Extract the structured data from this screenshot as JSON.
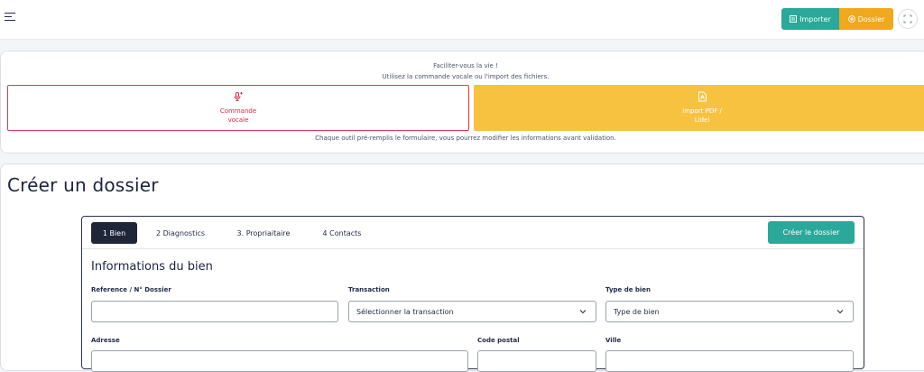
{
  "topbar": {
    "import_label": "Importer",
    "dossier_label": "Dossier",
    "colors": {
      "import": "#2aa899",
      "dossier": "#f0a81c"
    }
  },
  "helper": {
    "line1": "Faciliter-vous la vie !",
    "line2": "Utilisez la commande vocale ou l'import des fichiers.",
    "voice_label_1": "Commande",
    "voice_label_2": "vocale",
    "pdf_label_1": "Import PDF /",
    "pdf_label_2": "Lidel",
    "footer": "Chaque outil pré-remplis le formulaire, vous pourrez modifier les informations avant validation."
  },
  "page": {
    "title": "Créer un dossier"
  },
  "tabs": [
    {
      "label": "1 Bien",
      "active": true
    },
    {
      "label": "2 Diagnostics",
      "active": false
    },
    {
      "label": "3. Propriaitaire",
      "active": false
    },
    {
      "label": "4 Contacts",
      "active": false
    }
  ],
  "form": {
    "create_label": "Créer le dossier",
    "section_title": "Informations du bien",
    "reference": {
      "label": "Reference / N° Dossier",
      "value": ""
    },
    "transaction": {
      "label": "Transaction",
      "value": "Sélectionner la transaction"
    },
    "type_bien": {
      "label": "Type de bien",
      "value": "Type de bien"
    },
    "adresse": {
      "label": "Adresse",
      "value": ""
    },
    "code_postal": {
      "label": "Code postal",
      "value": ""
    },
    "ville": {
      "label": "Ville",
      "value": ""
    }
  }
}
